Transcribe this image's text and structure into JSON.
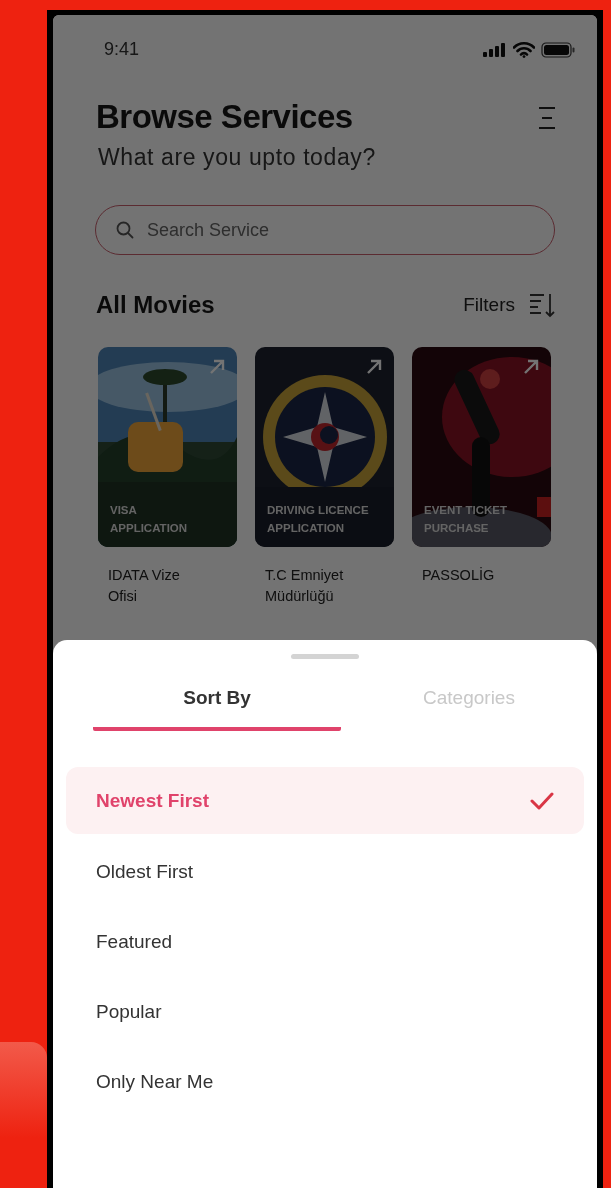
{
  "status_bar": {
    "time": "9:41"
  },
  "header": {
    "title": "Browse Services",
    "subtitle": "What are you upto today?"
  },
  "search": {
    "placeholder": "Search Service"
  },
  "section": {
    "title": "All Movies",
    "filters": "Filters"
  },
  "services": [
    {
      "tag": "VISA\nAPPLICATION",
      "name": "IDATA Vize\nOfisi",
      "kind": "picture"
    },
    {
      "tag": "DRIVING LICENCE\nAPPLICATION",
      "name": "T.C Emniyet\nMüdürlüğü",
      "kind": "picture"
    },
    {
      "tag": "EVENT TICKET\nPURCHASE",
      "name": "PASSOLİG",
      "kind": "picture"
    }
  ],
  "sheet": {
    "tabs": [
      {
        "label": "Sort By",
        "selected": true
      },
      {
        "label": "Categories",
        "selected": false
      }
    ],
    "options": [
      {
        "label": "Newest First",
        "selected": true
      },
      {
        "label": "Oldest First",
        "selected": false
      },
      {
        "label": "Featured",
        "selected": false
      },
      {
        "label": "Popular",
        "selected": false
      },
      {
        "label": "Only Near Me",
        "selected": false
      }
    ]
  }
}
